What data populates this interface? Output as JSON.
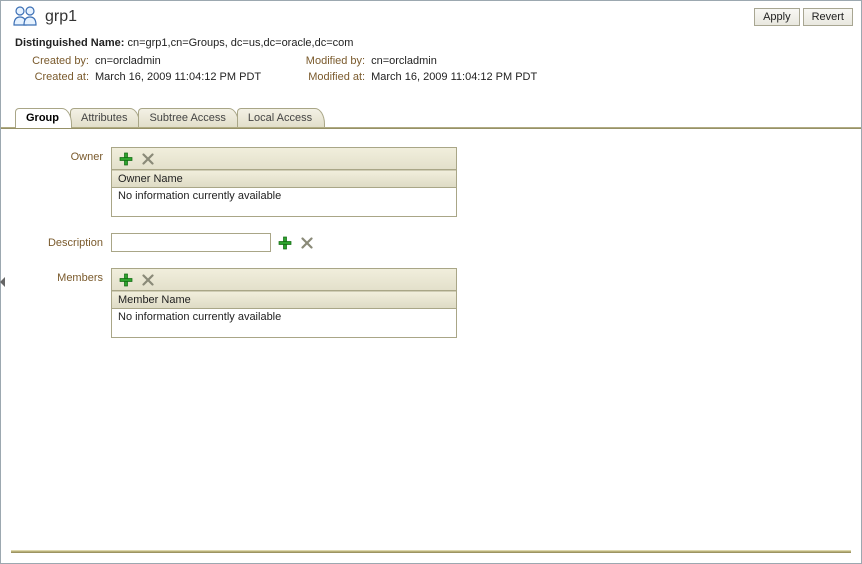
{
  "header": {
    "title": "grp1",
    "buttons": {
      "apply": "Apply",
      "revert": "Revert"
    }
  },
  "dn": {
    "label": "Distinguished Name:",
    "value": "cn=grp1,cn=Groups, dc=us,dc=oracle,dc=com"
  },
  "meta": {
    "created_by_lbl": "Created by:",
    "created_by": "cn=orcladmin",
    "created_at_lbl": "Created at:",
    "created_at": "March 16, 2009 11:04:12 PM PDT",
    "modified_by_lbl": "Modified by:",
    "modified_by": "cn=orcladmin",
    "modified_at_lbl": "Modified at:",
    "modified_at": "March 16, 2009 11:04:12 PM PDT"
  },
  "tabs": {
    "group": "Group",
    "attributes": "Attributes",
    "subtree": "Subtree Access",
    "local": "Local Access"
  },
  "group_tab": {
    "owner_label": "Owner",
    "owner_header": "Owner Name",
    "owner_empty": "No information currently available",
    "desc_label": "Description",
    "desc_value": "",
    "members_label": "Members",
    "members_header": "Member Name",
    "members_empty": "No information currently available"
  },
  "icons": {
    "add": "add-icon",
    "delete": "delete-icon"
  }
}
